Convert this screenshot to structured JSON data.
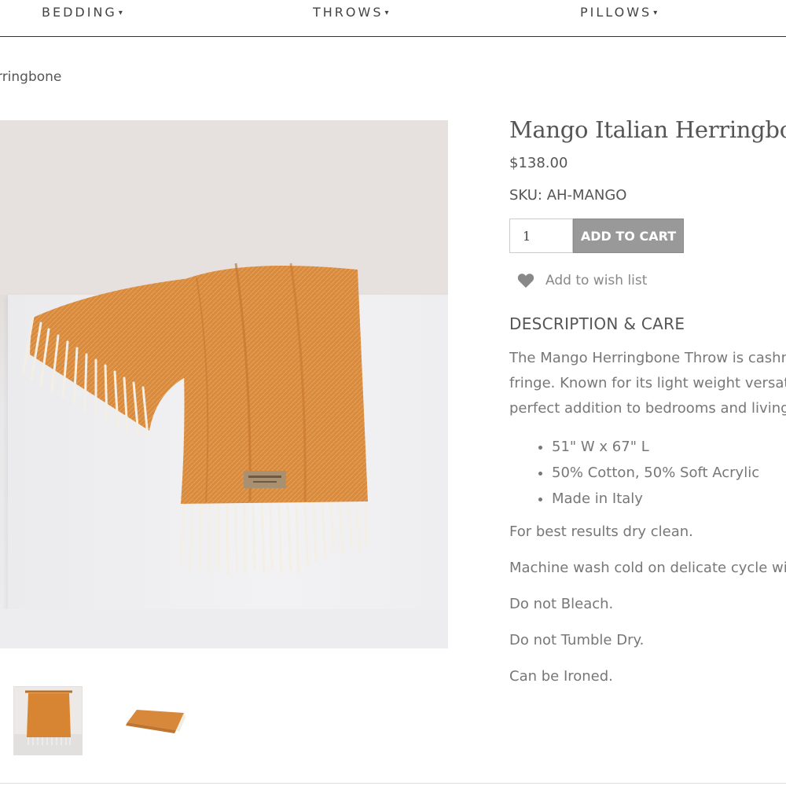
{
  "nav": {
    "items": [
      {
        "label": "BEDDING",
        "caret": "▾"
      },
      {
        "label": "THROWS",
        "caret": "▾"
      },
      {
        "label": "PILLOWS",
        "caret": "▾"
      }
    ]
  },
  "breadcrumb": {
    "current": "rringbone"
  },
  "product": {
    "title": "Mango Italian Herringbone",
    "price": "$138.00",
    "sku": "SKU: AH-MANGO",
    "quantity": "1",
    "add_to_cart": "ADD TO CART",
    "wishlist": "Add to wish list",
    "wishlist_icon": "heart-icon"
  },
  "description": {
    "heading": "DESCRIPTION & CARE",
    "lines": [
      "The Mango Herringbone Throw is cashme",
      "fringe. Known for its light weight versatilit",
      "perfect addition to bedrooms and living s"
    ],
    "bullets": [
      "51\" W x 67\" L",
      "50% Cotton, 50% Soft Acrylic",
      "Made in Italy"
    ],
    "care": [
      "For best results dry clean.",
      "Machine wash cold on delicate cycle with",
      "Do not Bleach.",
      "Do not Tumble Dry.",
      "Can be Ironed."
    ]
  },
  "colors": {
    "throw_orange": "#d98a3c",
    "fringe": "#f6f1e6",
    "button_gray": "#999999"
  }
}
